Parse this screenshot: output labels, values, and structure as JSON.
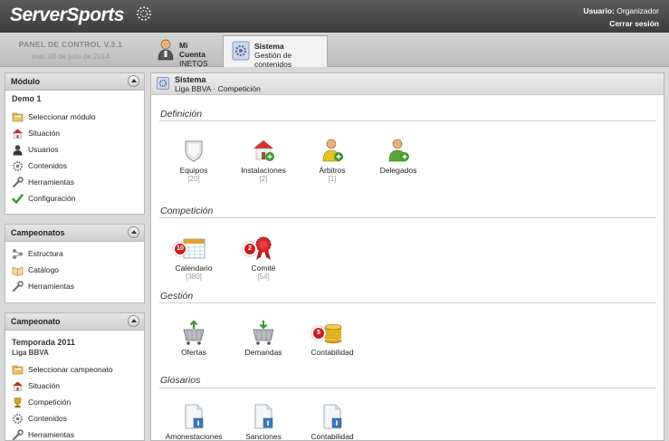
{
  "header": {
    "logo_text": "ServerSports",
    "user_label": "Usuario:",
    "user_name": "Organizador",
    "logout": "Cerrar sesión"
  },
  "control_panel": {
    "title": "PANEL DE CONTROL V.3.1",
    "date": "mar, 08 de julio de 2014"
  },
  "tabs": [
    {
      "label": "Mi Cuenta",
      "sub": "INETQS",
      "icon": "user-icon"
    },
    {
      "label": "Sistema",
      "sub": "Gestión de contenidos",
      "icon": "gear-icon",
      "active": true
    }
  ],
  "sidebar": {
    "modulo": {
      "title": "Módulo",
      "context": "Demo 1",
      "items": [
        {
          "label": "Seleccionar módulo",
          "icon": "folder-icon"
        },
        {
          "label": "Situación",
          "icon": "house-icon"
        },
        {
          "label": "Usuarios",
          "icon": "user-icon"
        },
        {
          "label": "Contenidos",
          "icon": "gear-icon"
        },
        {
          "label": "Herramientas",
          "icon": "wrench-icon"
        },
        {
          "label": "Configuración",
          "icon": "check-icon"
        }
      ]
    },
    "campeonatos": {
      "title": "Campeonatos",
      "items": [
        {
          "label": "Estructura",
          "icon": "structure-icon"
        },
        {
          "label": "Catálogo",
          "icon": "catalog-icon"
        },
        {
          "label": "Herramientas",
          "icon": "wrench-icon"
        }
      ]
    },
    "campeonato": {
      "title": "Campeonato",
      "context": "Temporada 2011",
      "context2": "Liga BBVA",
      "items": [
        {
          "label": "Seleccionar campeonato",
          "icon": "folder-icon"
        },
        {
          "label": "Situación",
          "icon": "house-icon"
        },
        {
          "label": "Competición",
          "icon": "trophy-icon"
        },
        {
          "label": "Contenidos",
          "icon": "gear-icon"
        },
        {
          "label": "Herramientas",
          "icon": "wrench-icon"
        }
      ]
    }
  },
  "content": {
    "title": "Sistema",
    "breadcrumb": "Liga BBVA · Competición",
    "sections": [
      {
        "title": "Definición",
        "items": [
          {
            "label": "Equipos",
            "count": "[20]",
            "icon": "shield-icon"
          },
          {
            "label": "Instalaciones",
            "count": "[2]",
            "icon": "building-icon"
          },
          {
            "label": "Árbitros",
            "count": "[1]",
            "icon": "referee-icon"
          },
          {
            "label": "Delegados",
            "count": "",
            "icon": "delegate-icon"
          }
        ]
      },
      {
        "title": "Competición",
        "items": [
          {
            "label": "Calendario",
            "count": "[380]",
            "icon": "calendar-icon",
            "badge": "10"
          },
          {
            "label": "Comité",
            "count": "[54]",
            "icon": "ribbon-icon",
            "badge": "2"
          }
        ]
      },
      {
        "title": "Gestión",
        "items": [
          {
            "label": "Ofertas",
            "count": "",
            "icon": "cart-up-icon"
          },
          {
            "label": "Demandas",
            "count": "",
            "icon": "cart-down-icon"
          },
          {
            "label": "Contabilidad",
            "count": "",
            "icon": "coins-icon",
            "badge": "5"
          }
        ]
      },
      {
        "title": "Glosarios",
        "items": [
          {
            "label": "Amonestaciones",
            "count": "",
            "icon": "document-icon"
          },
          {
            "label": "Sanciones",
            "count": "",
            "icon": "document-icon"
          },
          {
            "label": "Contabilidad",
            "count": "",
            "icon": "document-icon"
          }
        ]
      }
    ]
  },
  "colors": {
    "header_dark": "#3d3d3d",
    "badge_red": "#c81e1e",
    "panel_gray": "#d9d9d9"
  }
}
